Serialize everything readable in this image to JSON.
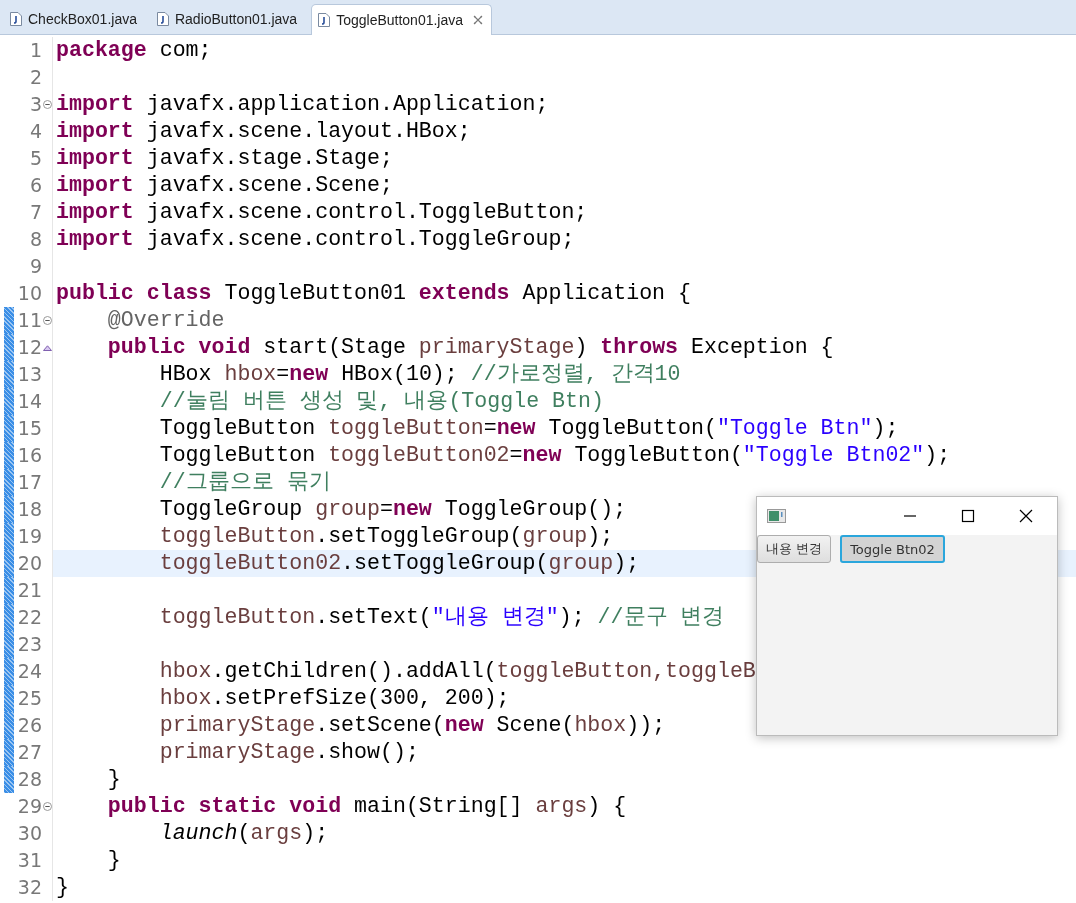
{
  "tabs": [
    {
      "label": "CheckBox01.java",
      "selected": false,
      "closable": false
    },
    {
      "label": "RadioButton01.java",
      "selected": false,
      "closable": false
    },
    {
      "label": "ToggleButton01.java",
      "selected": true,
      "closable": true
    }
  ],
  "editor": {
    "lines": [
      {
        "number": "1",
        "kind": "code",
        "changed": false,
        "current": false,
        "tokens": [
          {
            "kind": "keyword",
            "text": "package"
          },
          {
            "kind": "plain",
            "text": " com;"
          }
        ]
      },
      {
        "number": "2",
        "kind": "code",
        "changed": false,
        "current": false
      },
      {
        "number": "3",
        "kind": "fold",
        "changed": false,
        "current": false,
        "tokens": [
          {
            "kind": "keyword",
            "text": "import"
          },
          {
            "kind": "plain",
            "text": " javafx.application.Application;"
          }
        ]
      },
      {
        "number": "4",
        "kind": "code",
        "changed": false,
        "current": false,
        "tokens": [
          {
            "kind": "keyword",
            "text": "import"
          },
          {
            "kind": "plain",
            "text": " javafx.scene.layout.HBox;"
          }
        ]
      },
      {
        "number": "5",
        "kind": "code",
        "changed": false,
        "current": false,
        "tokens": [
          {
            "kind": "keyword",
            "text": "import"
          },
          {
            "kind": "plain",
            "text": " javafx.stage.Stage;"
          }
        ]
      },
      {
        "number": "6",
        "kind": "code",
        "changed": false,
        "current": false,
        "tokens": [
          {
            "kind": "keyword",
            "text": "import"
          },
          {
            "kind": "plain",
            "text": " javafx.scene.Scene;"
          }
        ]
      },
      {
        "number": "7",
        "kind": "code",
        "changed": false,
        "current": false,
        "tokens": [
          {
            "kind": "keyword",
            "text": "import"
          },
          {
            "kind": "plain",
            "text": " javafx.scene.control.ToggleButton;"
          }
        ]
      },
      {
        "number": "8",
        "kind": "code",
        "changed": false,
        "current": false,
        "tokens": [
          {
            "kind": "keyword",
            "text": "import"
          },
          {
            "kind": "plain",
            "text": " javafx.scene.control.ToggleGroup;"
          }
        ]
      },
      {
        "number": "9",
        "kind": "code",
        "changed": false,
        "current": false
      },
      {
        "number": "10",
        "kind": "code",
        "changed": false,
        "current": false,
        "tokens": [
          {
            "kind": "keyword",
            "text": "public class"
          },
          {
            "kind": "plain",
            "text": " ToggleButton01 "
          },
          {
            "kind": "keyword",
            "text": "extends"
          },
          {
            "kind": "plain",
            "text": " Application {"
          }
        ]
      },
      {
        "number": "11",
        "kind": "fold",
        "changed": true,
        "current": false,
        "tokens": [
          {
            "kind": "annotation",
            "text": "    @Override"
          }
        ]
      },
      {
        "number": "12",
        "kind": "override",
        "changed": true,
        "current": false,
        "tokens": [
          {
            "kind": "keyword",
            "text": "    public void"
          },
          {
            "kind": "plain",
            "text": " start(Stage "
          },
          {
            "kind": "variable",
            "text": "primaryStage"
          },
          {
            "kind": "plain",
            "text": ") "
          },
          {
            "kind": "keyword",
            "text": "throws"
          },
          {
            "kind": "plain",
            "text": " Exception {"
          }
        ]
      },
      {
        "number": "13",
        "kind": "code",
        "changed": true,
        "current": false,
        "tokens": [
          {
            "kind": "plain",
            "text": "        HBox "
          },
          {
            "kind": "variable",
            "text": "hbox"
          },
          {
            "kind": "plain",
            "text": "="
          },
          {
            "kind": "keyword",
            "text": "new"
          },
          {
            "kind": "plain",
            "text": " HBox(10); "
          },
          {
            "kind": "comment",
            "text": "//가로정렬, 간격10"
          }
        ]
      },
      {
        "number": "14",
        "kind": "code",
        "changed": true,
        "current": false,
        "tokens": [
          {
            "kind": "comment",
            "text": "        //눌림 버튼 생성 및, 내용(Toggle Btn)"
          }
        ]
      },
      {
        "number": "15",
        "kind": "code",
        "changed": true,
        "current": false,
        "tokens": [
          {
            "kind": "plain",
            "text": "        ToggleButton "
          },
          {
            "kind": "variable",
            "text": "toggleButton"
          },
          {
            "kind": "plain",
            "text": "="
          },
          {
            "kind": "keyword",
            "text": "new"
          },
          {
            "kind": "plain",
            "text": " ToggleButton("
          },
          {
            "kind": "string",
            "text": "\"Toggle Btn\""
          },
          {
            "kind": "plain",
            "text": ");"
          }
        ]
      },
      {
        "number": "16",
        "kind": "code",
        "changed": true,
        "current": false,
        "tokens": [
          {
            "kind": "plain",
            "text": "        ToggleButton "
          },
          {
            "kind": "variable",
            "text": "toggleButton02"
          },
          {
            "kind": "plain",
            "text": "="
          },
          {
            "kind": "keyword",
            "text": "new"
          },
          {
            "kind": "plain",
            "text": " ToggleButton("
          },
          {
            "kind": "string",
            "text": "\"Toggle Btn02\""
          },
          {
            "kind": "plain",
            "text": ");"
          }
        ]
      },
      {
        "number": "17",
        "kind": "code",
        "changed": true,
        "current": false,
        "tokens": [
          {
            "kind": "comment",
            "text": "        //그룹으로 묶기"
          }
        ]
      },
      {
        "number": "18",
        "kind": "code",
        "changed": true,
        "current": false,
        "tokens": [
          {
            "kind": "plain",
            "text": "        ToggleGroup "
          },
          {
            "kind": "variable",
            "text": "group"
          },
          {
            "kind": "plain",
            "text": "="
          },
          {
            "kind": "keyword",
            "text": "new"
          },
          {
            "kind": "plain",
            "text": " ToggleGroup();"
          }
        ]
      },
      {
        "number": "19",
        "kind": "code",
        "changed": true,
        "current": false,
        "tokens": [
          {
            "kind": "variable",
            "text": "        toggleButton"
          },
          {
            "kind": "plain",
            "text": ".setToggleGroup("
          },
          {
            "kind": "variable",
            "text": "group"
          },
          {
            "kind": "plain",
            "text": ");"
          }
        ]
      },
      {
        "number": "20",
        "kind": "code",
        "changed": true,
        "current": true,
        "tokens": [
          {
            "kind": "variable",
            "text": "        toggleButton02"
          },
          {
            "kind": "plain",
            "text": ".setToggleGroup("
          },
          {
            "kind": "variable",
            "text": "group"
          },
          {
            "kind": "plain",
            "text": ");"
          }
        ]
      },
      {
        "number": "21",
        "kind": "code",
        "changed": true,
        "current": false
      },
      {
        "number": "22",
        "kind": "code",
        "changed": true,
        "current": false,
        "tokens": [
          {
            "kind": "variable",
            "text": "        toggleButton"
          },
          {
            "kind": "plain",
            "text": ".setText("
          },
          {
            "kind": "string",
            "text": "\"내용 변경\""
          },
          {
            "kind": "plain",
            "text": "); "
          },
          {
            "kind": "comment",
            "text": "//문구 변경"
          }
        ]
      },
      {
        "number": "23",
        "kind": "code",
        "changed": true,
        "current": false
      },
      {
        "number": "24",
        "kind": "code",
        "changed": true,
        "current": false,
        "tokens": [
          {
            "kind": "variable",
            "text": "        hbox"
          },
          {
            "kind": "plain",
            "text": ".getChildren().addAll("
          },
          {
            "kind": "variable",
            "text": "toggleButton"
          },
          {
            "kind": "variable",
            "text": ",toggleB"
          }
        ]
      },
      {
        "number": "25",
        "kind": "code",
        "changed": true,
        "current": false,
        "tokens": [
          {
            "kind": "variable",
            "text": "        hbox"
          },
          {
            "kind": "plain",
            "text": ".setPrefSize(300, 200);"
          }
        ]
      },
      {
        "number": "26",
        "kind": "code",
        "changed": true,
        "current": false,
        "tokens": [
          {
            "kind": "variable",
            "text": "        primaryStage"
          },
          {
            "kind": "plain",
            "text": ".setScene("
          },
          {
            "kind": "keyword",
            "text": "new"
          },
          {
            "kind": "plain",
            "text": " Scene("
          },
          {
            "kind": "variable",
            "text": "hbox"
          },
          {
            "kind": "plain",
            "text": "));"
          }
        ]
      },
      {
        "number": "27",
        "kind": "code",
        "changed": true,
        "current": false,
        "tokens": [
          {
            "kind": "variable",
            "text": "        primaryStage"
          },
          {
            "kind": "plain",
            "text": ".show();"
          }
        ]
      },
      {
        "number": "28",
        "kind": "code",
        "changed": true,
        "current": false,
        "tokens": [
          {
            "kind": "plain",
            "text": "    }"
          }
        ]
      },
      {
        "number": "29",
        "kind": "fold",
        "changed": false,
        "current": false,
        "tokens": [
          {
            "kind": "keyword",
            "text": "    public static void"
          },
          {
            "kind": "plain",
            "text": " main(String[] "
          },
          {
            "kind": "variable",
            "text": "args"
          },
          {
            "kind": "plain",
            "text": ") {"
          }
        ]
      },
      {
        "number": "30",
        "kind": "code",
        "changed": false,
        "current": false,
        "tokens": [
          {
            "kind": "static",
            "text": "        launch"
          },
          {
            "kind": "plain",
            "text": "("
          },
          {
            "kind": "variable",
            "text": "args"
          },
          {
            "kind": "plain",
            "text": ");"
          }
        ]
      },
      {
        "number": "31",
        "kind": "code",
        "changed": false,
        "current": false,
        "tokens": [
          {
            "kind": "plain",
            "text": "    }"
          }
        ]
      },
      {
        "number": "32",
        "kind": "code",
        "changed": false,
        "current": false,
        "tokens": [
          {
            "kind": "plain",
            "text": "}"
          }
        ]
      }
    ]
  },
  "app_window": {
    "buttons": [
      {
        "label": "내용 변경",
        "selected": false
      },
      {
        "label": "Toggle Btn02",
        "selected": true
      }
    ]
  }
}
